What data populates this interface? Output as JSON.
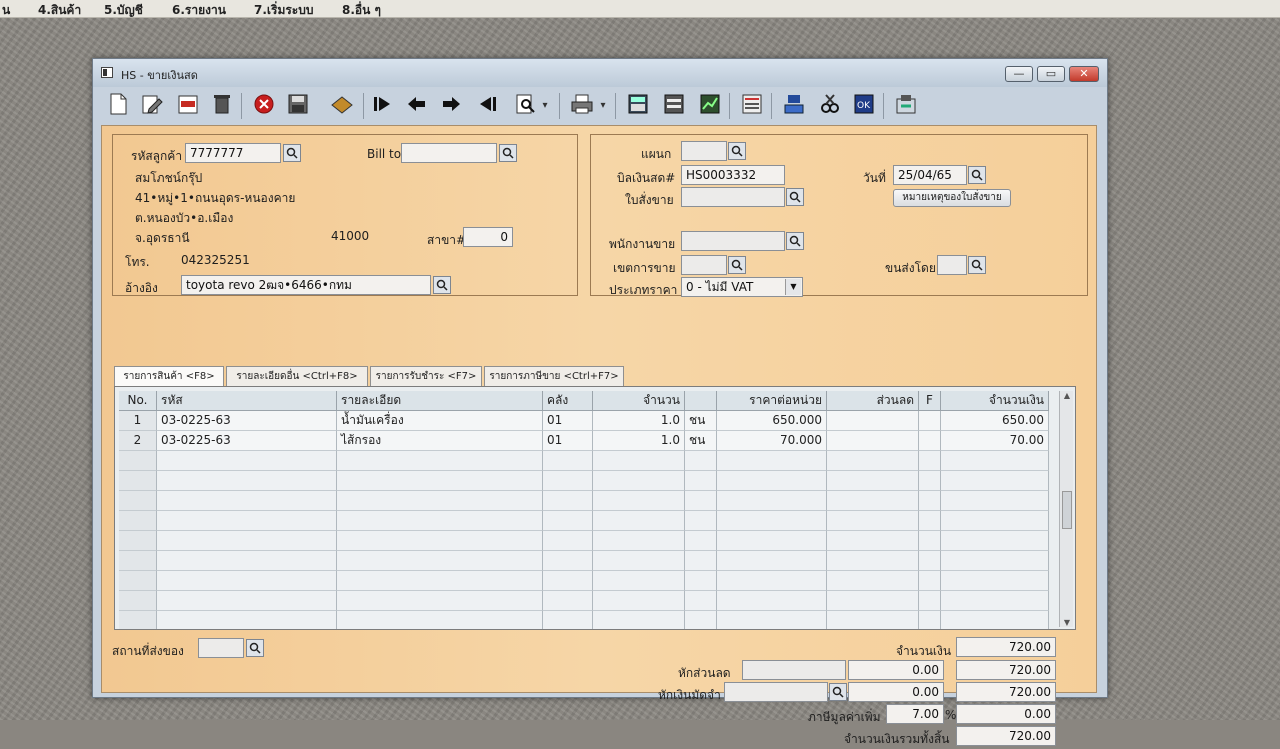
{
  "menubar": {
    "items": [
      "น",
      "4.สินค้า",
      "5.บัญชี",
      "6.รายงาน",
      "7.เริ่มระบบ",
      "8.อื่น ๆ"
    ]
  },
  "window": {
    "title": "HS - ขายเงินสด",
    "minimize": "—",
    "maximize": "▭",
    "close": "✕"
  },
  "toolbar": {
    "icons": [
      "new-document-icon",
      "edit-icon",
      "delete-icon",
      "trash-icon",
      "cancel-icon",
      "save-icon",
      "stamp-icon",
      "first-record-icon",
      "previous-record-icon",
      "next-record-icon",
      "last-record-icon",
      "find-icon",
      "print-icon",
      "calculator-icon",
      "list-icon",
      "chart-icon",
      "receipt-icon",
      "doc-icon",
      "tools-icon",
      "ok-icon",
      "export-icon"
    ]
  },
  "customer": {
    "code_label": "รหัสลูกค้า",
    "code": "7777777",
    "bill_to_label": "Bill to",
    "bill_to": "",
    "name": "สมโภชน์กรุ๊ป",
    "address1": "41•หมู่•1•ถนนอุดร-หนองคาย",
    "address2": "ต.หนองบัว•อ.เมือง",
    "province": "จ.อุดรธานี",
    "postcode": "41000",
    "branch_label": "สาขา#",
    "branch": "0",
    "phone_label": "โทร.",
    "phone": "042325251",
    "reference_label": "อ้างอิง",
    "reference": "toyota revo 2ฒจ•6466•กทม"
  },
  "document": {
    "department_label": "แผนก",
    "department": "",
    "cash_bill_label": "บิลเงินสด#",
    "cash_bill": "HS0003332",
    "date_label": "วันที่",
    "date": "25/04/65",
    "sales_order_label": "ใบสั่งขาย",
    "sales_order": "",
    "sales_order_note_button": "หมายเหตุของใบสั่งขาย",
    "salesperson_label": "พนักงานขาย",
    "salesperson": "",
    "sales_area_label": "เขตการขาย",
    "sales_area": "",
    "ship_by_label": "ขนส่งโดย",
    "ship_by": "",
    "price_type_label": "ประเภทราคา",
    "price_type": "0 - ไม่มี VAT"
  },
  "tabs": [
    {
      "label": "รายการสินค้า <F8>"
    },
    {
      "label": "รายละเอียดอื่น <Ctrl+F8>"
    },
    {
      "label": "รายการรับชำระ <F7>"
    },
    {
      "label": "รายการภาษีขาย <Ctrl+F7>"
    }
  ],
  "grid": {
    "headers": [
      "No.",
      "รหัส",
      "รายละเอียด",
      "คลัง",
      "จำนวน",
      "",
      "ราคาต่อหน่วย",
      "ส่วนลด",
      "F",
      "จำนวนเงิน"
    ],
    "rows": [
      [
        "1",
        "03-0225-63",
        "น้ำมันเครื่อง",
        "01",
        "1.0",
        "ชน",
        "650.000",
        "",
        "",
        "650.00"
      ],
      [
        "2",
        "03-0225-63",
        "ไส้กรอง",
        "01",
        "1.0",
        "ชน",
        "70.000",
        "",
        "",
        "70.00"
      ]
    ]
  },
  "footer": {
    "ship_place_label": "สถานที่ส่งของ",
    "ship_place": "",
    "amount_label": "จำนวนเงิน",
    "amount": "720.00",
    "discount_label": "หักส่วนลด",
    "discount_code": "",
    "discount_value": "0.00",
    "after_discount": "720.00",
    "deposit_label": "หักเงินมัดจำ",
    "deposit_code": "",
    "deposit_value": "0.00",
    "after_deposit": "720.00",
    "vat_label": "ภาษีมูลค่าเพิ่ม",
    "vat_rate": "7.00",
    "vat_percent": "%",
    "vat_amount": "0.00",
    "total_label": "จำนวนเงินรวมทั้งสิ้น",
    "total": "720.00"
  }
}
